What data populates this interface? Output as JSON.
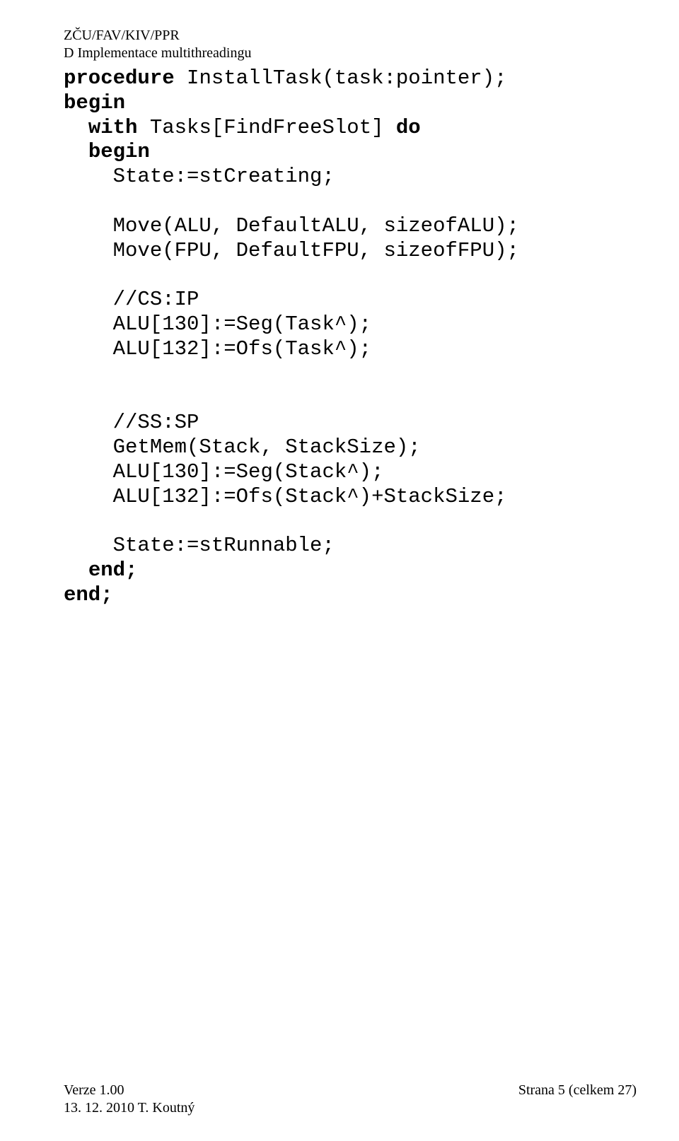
{
  "header": {
    "line1": "ZČU/FAV/KIV/PPR",
    "line2": "D Implementace multithreadingu"
  },
  "code": {
    "kw_procedure": "procedure",
    "sig_rest": " InstallTask(task:pointer);",
    "kw_begin1": "begin",
    "indent_with": "  ",
    "kw_with": "with",
    "with_rest": " Tasks[FindFreeSlot] ",
    "kw_do": "do",
    "indent_begin2": "  ",
    "kw_begin2": "begin",
    "l_state1": "    State:=stCreating;",
    "blank": "",
    "l_move1": "    Move(ALU, DefaultALU, sizeofALU);",
    "l_move2": "    Move(FPU, DefaultFPU, sizeofFPU);",
    "l_csip": "    //CS:IP",
    "l_alu130t": "    ALU[130]:=Seg(Task^);",
    "l_alu132t": "    ALU[132]:=Ofs(Task^);",
    "l_sssp": "    //SS:SP",
    "l_getmem": "    GetMem(Stack, StackSize);",
    "l_alu130s": "    ALU[130]:=Seg(Stack^);",
    "l_alu132s": "    ALU[132]:=Ofs(Stack^)+StackSize;",
    "l_state2": "    State:=stRunnable;",
    "indent_end1": "  ",
    "kw_end1": "end;",
    "kw_end2": "end;"
  },
  "footer": {
    "version": "Verze 1.00",
    "date_author": "13. 12. 2010 T. Koutný",
    "page_info": "Strana 5 (celkem 27)"
  }
}
